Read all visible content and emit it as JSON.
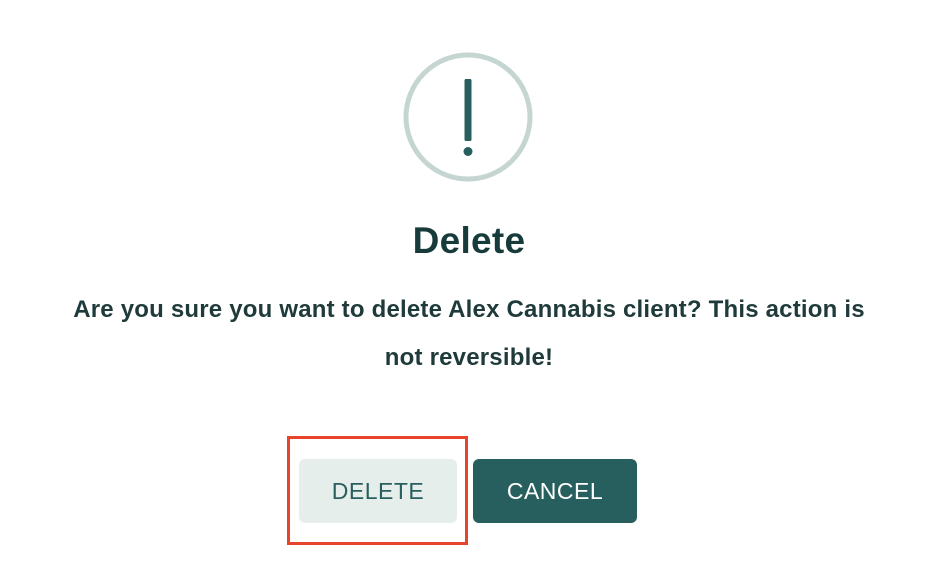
{
  "dialog": {
    "icon": "exclamation-circle-icon",
    "title": "Delete",
    "message": "Are you sure you want to delete Alex Cannabis client? This action is not reversible!",
    "buttons": {
      "delete_label": "DELETE",
      "cancel_label": "CANCEL"
    }
  },
  "colors": {
    "icon_ring": "#c4d5d2",
    "icon_mark": "#275f5e",
    "title_text": "#173b3b",
    "delete_bg": "#e6eeec",
    "delete_text": "#2a5f5f",
    "cancel_bg": "#275f5e",
    "cancel_text": "#ffffff",
    "highlight": "#e8432b"
  }
}
